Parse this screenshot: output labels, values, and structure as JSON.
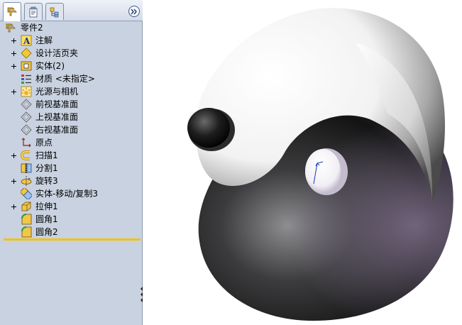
{
  "feature_tree": {
    "tabs": [
      "feature-manager",
      "property-manager",
      "configuration-manager"
    ],
    "root": {
      "label": "零件2",
      "icon": "part-icon"
    },
    "items": [
      {
        "label": "注解",
        "icon": "annotations-icon",
        "expandable": true
      },
      {
        "label": "设计活页夹",
        "icon": "design-binder-icon",
        "expandable": true
      },
      {
        "label": "实体(2)",
        "icon": "solid-bodies-icon",
        "expandable": true
      },
      {
        "label": "材质 <未指定>",
        "icon": "material-icon",
        "expandable": false
      },
      {
        "label": "光源与相机",
        "icon": "lights-cameras-icon",
        "expandable": true
      },
      {
        "label": "前视基准面",
        "icon": "plane-icon",
        "expandable": false
      },
      {
        "label": "上视基准面",
        "icon": "plane-icon",
        "expandable": false
      },
      {
        "label": "右视基准面",
        "icon": "plane-icon",
        "expandable": false
      },
      {
        "label": "原点",
        "icon": "origin-icon",
        "expandable": false
      },
      {
        "label": "扫描1",
        "icon": "sweep-icon",
        "expandable": true
      },
      {
        "label": "分割1",
        "icon": "split-icon",
        "expandable": false
      },
      {
        "label": "旋转3",
        "icon": "revolve-icon",
        "expandable": true
      },
      {
        "label": "实体-移动/复制3",
        "icon": "move-copy-icon",
        "expandable": false
      },
      {
        "label": "拉伸1",
        "icon": "extrude-icon",
        "expandable": true
      },
      {
        "label": "圆角1",
        "icon": "fillet-icon",
        "expandable": false
      },
      {
        "label": "圆角2",
        "icon": "fillet-icon",
        "expandable": false
      }
    ]
  },
  "colors": {
    "panel_bg": "#c9d2e0",
    "rollback_bar": "#f2c313",
    "model_dark": "#1a1a1a",
    "model_light": "#ffffff"
  }
}
